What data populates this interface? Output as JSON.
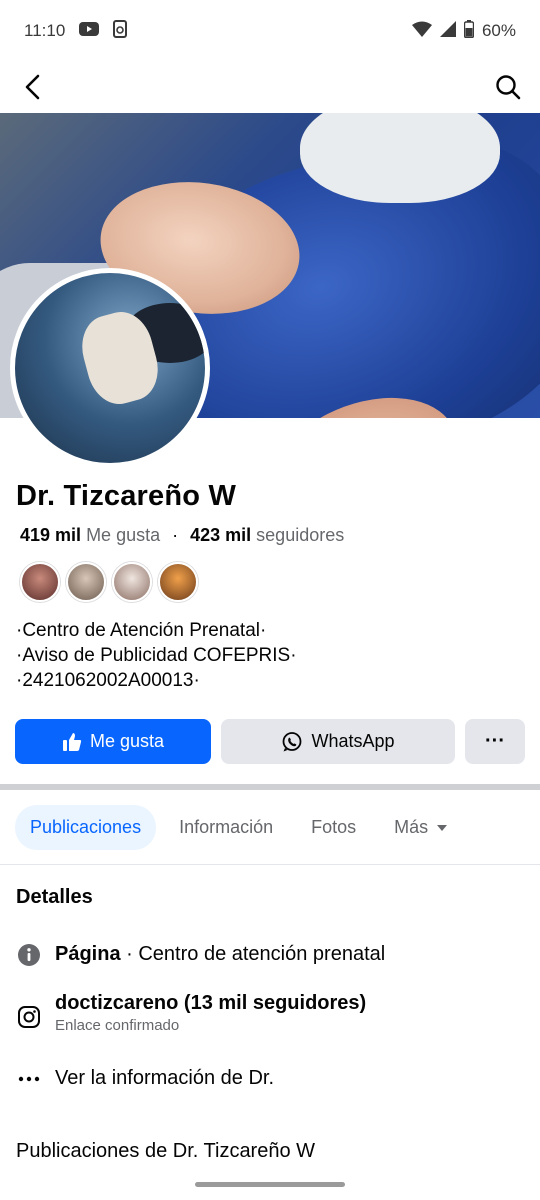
{
  "status_bar": {
    "time": "11:10",
    "battery": "60%"
  },
  "profile": {
    "name": "Dr. Tizcareño W",
    "likes_count": "419 mil",
    "likes_label": "Me gusta",
    "separator": "·",
    "followers_count": "423 mil",
    "followers_label": "seguidores",
    "bio": [
      "·Centro de Atención Prenatal·",
      "·Aviso de Publicidad COFEPRIS·",
      "·2421062002A00013·"
    ]
  },
  "actions": {
    "like_label": "Me gusta",
    "whatsapp_label": "WhatsApp",
    "more_label": "···"
  },
  "tabs": [
    {
      "label": "Publicaciones",
      "active": true
    },
    {
      "label": "Información"
    },
    {
      "label": "Fotos"
    },
    {
      "label": "Más"
    }
  ],
  "details": {
    "title": "Detalles",
    "page_label": "Página",
    "page_value": "· Centro de atención prenatal",
    "instagram_text": "doctizcareno (13 mil seguidores)",
    "instagram_sub": "Enlace confirmado",
    "more_info": "Ver la información de Dr."
  },
  "posts_title": "Publicaciones de Dr. Tizcareño W",
  "colors": {
    "accent": "#0866ff",
    "button_gray": "#e4e6eb",
    "tab_active_bg": "#ebf5ff"
  }
}
